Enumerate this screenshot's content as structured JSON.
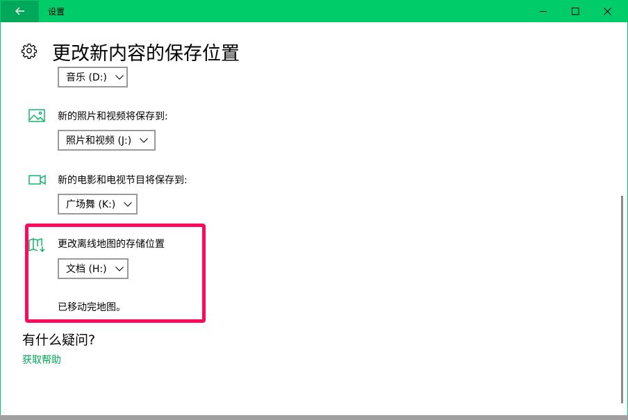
{
  "window": {
    "title": "设置",
    "accent_color": "#00cc6a",
    "back_icon": "arrow-left-icon",
    "controls": [
      "minimize-icon",
      "maximize-icon",
      "close-icon"
    ]
  },
  "page": {
    "title": "更改新内容的保存位置",
    "icon": "gear-icon"
  },
  "sections": {
    "music": {
      "dropdown_value": "音乐 (D:)"
    },
    "photos": {
      "label": "新的照片和视频将保存到:",
      "icon": "image-icon",
      "dropdown_value": "照片和视频 (J:)"
    },
    "movies": {
      "label": "新的电影和电视节目将保存到:",
      "icon": "video-camera-icon",
      "dropdown_value": "广场舞 (K:)"
    },
    "maps": {
      "label": "更改离线地图的存储位置",
      "icon": "map-download-icon",
      "dropdown_value": "文档 (H:)",
      "status": "已移动完地图。"
    }
  },
  "faq": {
    "heading": "有什么疑问?",
    "help_link": "获取帮助"
  },
  "highlight_color": "#ff0a5a"
}
